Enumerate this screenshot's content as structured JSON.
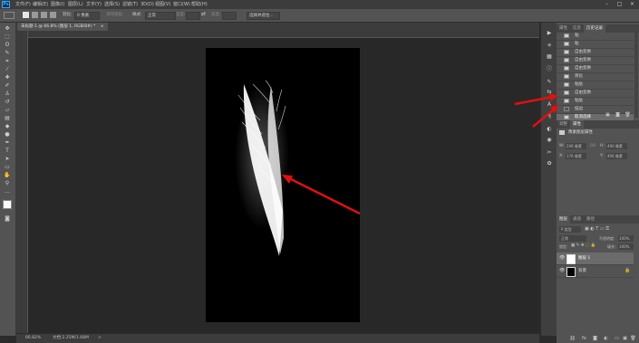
{
  "menubar": {
    "logo": "Ps",
    "items": [
      "文件(F)",
      "编辑(E)",
      "图像(I)",
      "图层(L)",
      "文字(Y)",
      "选择(S)",
      "滤镜(T)",
      "3D(D)",
      "视图(V)",
      "窗口(W)",
      "帮助(H)"
    ],
    "win_controls": [
      "–",
      "□",
      "×"
    ]
  },
  "options": {
    "feather_label": "羽化:",
    "feather_value": "0 像素",
    "antialias_label": "消除锯齿",
    "style_label": "样式:",
    "style_value": "正常",
    "width_label": "宽度:",
    "height_label": "高度:",
    "select_mask_label": "选择并遮住..."
  },
  "document": {
    "tab_title": "未标题-1 @ 66.8% (图层 1, RGB/8#) *",
    "tab_close": "×"
  },
  "status": {
    "zoom": "66.82%",
    "doc_info": "文档:2.25M/1.68M",
    "arrow": ">"
  },
  "history": {
    "tabs": [
      "属性",
      "信息",
      "历史记录"
    ],
    "active_tab": "历史记录",
    "items": [
      "粘",
      "粘",
      "自由变换",
      "自由变换",
      "自由变换",
      "液化",
      "粘贴",
      "自由变换",
      "粘贴",
      "描边",
      "取消选择"
    ],
    "selected_index": 10
  },
  "properties": {
    "tabs": [
      "调整",
      "属性"
    ],
    "header": "像素图层属性",
    "w_label": "W:",
    "w_value": "246 像素",
    "h_label": "H:",
    "h_value": "490 像素",
    "x_label": "X:",
    "x_value": "176 像素",
    "y_label": "Y:",
    "y_value": "406 像素",
    "link_label": "GO"
  },
  "layers": {
    "tabs": [
      "图层",
      "通道",
      "路径"
    ],
    "kind_label": "P 类型",
    "blend_mode": "正常",
    "opacity_label": "不透明度:",
    "opacity_value": "100%",
    "lock_label": "锁定:",
    "fill_label": "填充:",
    "fill_value": "100%",
    "items": [
      {
        "name": "图层 1",
        "selected": true
      },
      {
        "name": "背景",
        "selected": false
      }
    ]
  },
  "colors": {
    "arrow": "#e01010",
    "accent": "#31a8ff"
  }
}
